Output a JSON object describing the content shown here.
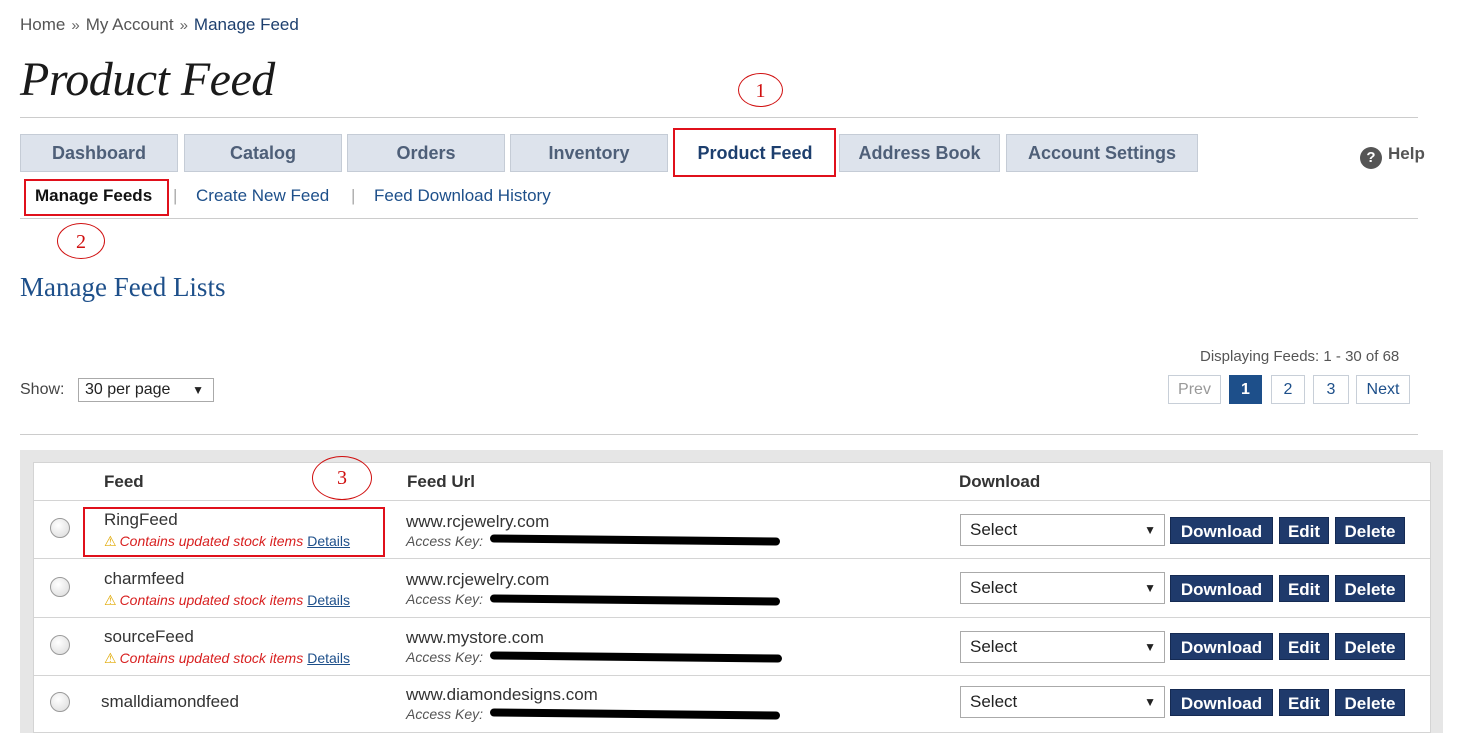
{
  "breadcrumb": {
    "home": "Home",
    "account": "My Account",
    "current": "Manage Feed",
    "sep": "»"
  },
  "page_title": "Product Feed",
  "tabs": [
    {
      "label": "Dashboard"
    },
    {
      "label": "Catalog"
    },
    {
      "label": "Orders"
    },
    {
      "label": "Inventory"
    },
    {
      "label": "Product Feed"
    },
    {
      "label": "Address Book"
    },
    {
      "label": "Account Settings"
    }
  ],
  "help": {
    "icon": "?",
    "label": "Help"
  },
  "subnav": [
    {
      "label": "Manage Feeds"
    },
    {
      "label": "Create New Feed"
    },
    {
      "label": "Feed Download History"
    }
  ],
  "subnav_sep": "|",
  "annotations": [
    "1",
    "2",
    "3"
  ],
  "section_title": "Manage Feed Lists",
  "pagination": {
    "summary": "Displaying Feeds: 1 - 30 of 68",
    "prev": "Prev",
    "pages": [
      "1",
      "2",
      "3"
    ],
    "next": "Next",
    "current_page": "1"
  },
  "show": {
    "label": "Show:",
    "value": "30 per page",
    "arrow": "▼"
  },
  "table": {
    "headers": {
      "feed": "Feed",
      "url": "Feed Url",
      "download": "Download"
    },
    "warning_text": "Contains updated stock items",
    "warning_icon": "⚠",
    "details_label": "Details",
    "access_key_label": "Access Key:",
    "select_value": "Select",
    "select_arrow": "▼",
    "download_label": "Download",
    "edit_label": "Edit",
    "delete_label": "Delete",
    "rows": [
      {
        "name": "RingFeed",
        "url": "www.rcjewelry.com"
      },
      {
        "name": "charmfeed",
        "url": "www.rcjewelry.com"
      },
      {
        "name": "sourceFeed",
        "url": "www.mystore.com"
      },
      {
        "name": "smalldiamondfeed",
        "url": "www.diamondesigns.com"
      }
    ]
  },
  "colors": {
    "accent": "#1d4f8a",
    "button": "#1f3a6b",
    "annotation": "#e0101b",
    "warning": "#d82020"
  }
}
